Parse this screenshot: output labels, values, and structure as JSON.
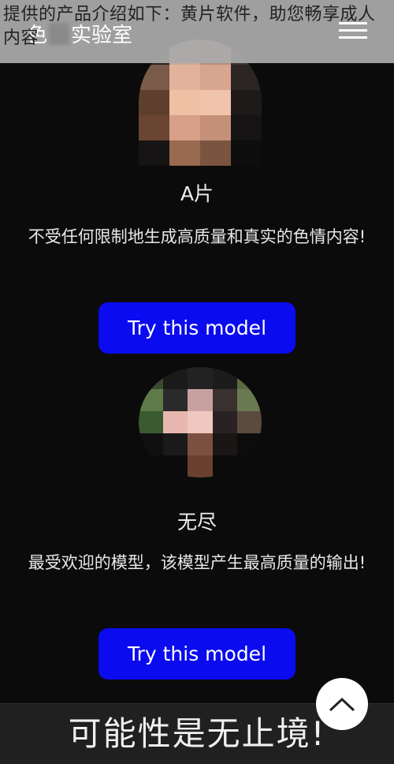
{
  "overlay_caption": "提供的产品介绍如下：黄片软件，助您畅享成人内容",
  "header": {
    "logo_prefix": "色",
    "logo_suffix": "实验室",
    "menu_icon": "hamburger-icon"
  },
  "models": [
    {
      "name": "A片",
      "description": "不受任何限制地生成高质量和真实的色情内容!",
      "button_label": "Try this model"
    },
    {
      "name": "无尽",
      "description": "最受欢迎的模型，该模型产生最高质量的输出!",
      "button_label": "Try this model"
    }
  ],
  "footer": {
    "tagline": "可能性是无止境!"
  },
  "colors": {
    "button": "#0b0bef",
    "background": "#0b0b0b",
    "footer": "#202020"
  }
}
